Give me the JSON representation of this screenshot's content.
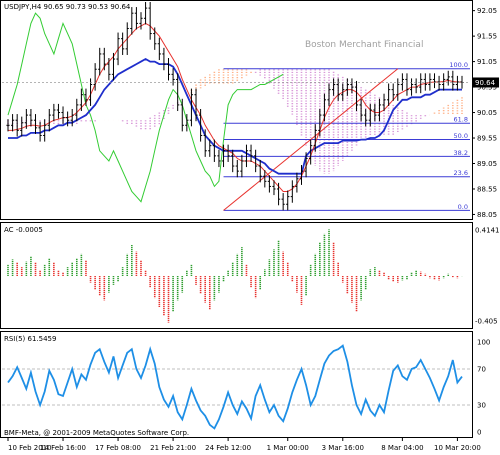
{
  "chart_data": [
    {
      "type": "line",
      "panel": "main",
      "header": "USDJPY,H4  90.65 90.73 90.53 90.64",
      "watermark": "Boston Merchant Financial",
      "current_price_label": "90.64",
      "y_ticks": [
        {
          "v": 92.05,
          "label": "92.05"
        },
        {
          "v": 91.55,
          "label": "91.55"
        },
        {
          "v": 91.05,
          "label": "91.05"
        },
        {
          "v": 90.55,
          "label": "90.55"
        },
        {
          "v": 90.05,
          "label": "90.05"
        },
        {
          "v": 89.55,
          "label": "89.55"
        },
        {
          "v": 89.05,
          "label": "89.05"
        },
        {
          "v": 88.55,
          "label": "88.55"
        },
        {
          "v": 88.05,
          "label": "88.05"
        }
      ],
      "ylim": [
        88.0,
        92.2
      ],
      "x_count": 100,
      "fibonacci": [
        {
          "label": "100.0",
          "v": 90.91
        },
        {
          "label": "61.8",
          "v": 89.84
        },
        {
          "label": "50.0",
          "v": 89.52
        },
        {
          "label": "38.2",
          "v": 89.19
        },
        {
          "label": "23.6",
          "v": 88.79
        },
        {
          "label": "0.0",
          "v": 88.13
        }
      ],
      "fib_start_x": 47,
      "fib_trendline": {
        "x1": 47,
        "y1": 88.13,
        "x2": 85,
        "y2": 90.91
      },
      "price_close": [
        89.8,
        89.9,
        89.7,
        89.85,
        90.0,
        89.9,
        89.75,
        89.6,
        89.8,
        90.0,
        90.1,
        90.05,
        89.95,
        89.9,
        90.0,
        90.2,
        90.4,
        90.3,
        90.6,
        90.9,
        91.2,
        91.0,
        90.8,
        91.1,
        91.5,
        91.3,
        91.7,
        92.0,
        91.8,
        91.9,
        92.1,
        91.6,
        91.4,
        91.2,
        91.0,
        90.8,
        90.7,
        90.2,
        89.8,
        89.9,
        90.4,
        90.0,
        89.6,
        89.3,
        89.4,
        89.2,
        89.1,
        89.3,
        89.2,
        89.0,
        88.9,
        89.1,
        89.3,
        89.2,
        89.0,
        88.8,
        88.7,
        88.6,
        88.55,
        88.35,
        88.25,
        88.4,
        88.6,
        88.75,
        88.9,
        89.15,
        89.4,
        89.7,
        90.0,
        90.3,
        90.5,
        90.6,
        90.4,
        90.5,
        90.6,
        90.55,
        90.2,
        90.0,
        89.9,
        90.1,
        90.0,
        90.2,
        90.3,
        90.5,
        90.4,
        90.6,
        90.7,
        90.5,
        90.6,
        90.55,
        90.7,
        90.6,
        90.7,
        90.65,
        90.6,
        90.7,
        90.75,
        90.6,
        90.65,
        90.64
      ],
      "series": [
        {
          "key": "tenkan",
          "color": "#e8322e",
          "values": [
            89.7,
            89.7,
            89.72,
            89.74,
            89.78,
            89.8,
            89.8,
            89.78,
            89.8,
            89.85,
            89.9,
            89.92,
            89.95,
            89.95,
            89.98,
            90.05,
            90.15,
            90.25,
            90.4,
            90.6,
            90.8,
            90.95,
            91.05,
            91.15,
            91.3,
            91.4,
            91.5,
            91.6,
            91.7,
            91.75,
            91.8,
            91.75,
            91.65,
            91.55,
            91.4,
            91.25,
            91.1,
            90.95,
            90.7,
            90.5,
            90.3,
            90.15,
            90.0,
            89.8,
            89.65,
            89.5,
            89.4,
            89.35,
            89.3,
            89.25,
            89.15,
            89.1,
            89.1,
            89.1,
            89.05,
            89.0,
            88.9,
            88.8,
            88.7,
            88.6,
            88.5,
            88.5,
            88.55,
            88.65,
            88.8,
            89.0,
            89.2,
            89.45,
            89.7,
            89.95,
            90.15,
            90.3,
            90.4,
            90.45,
            90.5,
            90.5,
            90.45,
            90.35,
            90.2,
            90.1,
            90.05,
            90.05,
            90.1,
            90.2,
            90.3,
            90.4,
            90.45,
            90.5,
            90.55,
            90.55,
            90.6,
            90.62,
            90.64,
            90.65,
            90.65,
            90.66,
            90.68,
            90.66,
            90.65,
            90.65
          ]
        },
        {
          "key": "kijun",
          "color": "#1f2ecc",
          "values": [
            89.55,
            89.55,
            89.55,
            89.6,
            89.6,
            89.65,
            89.65,
            89.65,
            89.7,
            89.7,
            89.75,
            89.8,
            89.8,
            89.85,
            89.85,
            89.9,
            89.95,
            90.0,
            90.1,
            90.2,
            90.35,
            90.5,
            90.6,
            90.7,
            90.8,
            90.85,
            90.9,
            90.95,
            91.0,
            91.05,
            91.1,
            91.05,
            91.05,
            91.0,
            91.0,
            91.0,
            90.95,
            90.8,
            90.6,
            90.4,
            90.2,
            90.0,
            89.8,
            89.6,
            89.5,
            89.4,
            89.35,
            89.3,
            89.3,
            89.3,
            89.3,
            89.3,
            89.25,
            89.2,
            89.15,
            89.1,
            89.05,
            88.95,
            88.9,
            88.85,
            88.85,
            88.85,
            88.85,
            88.85,
            88.85,
            89.2,
            89.3,
            89.35,
            89.4,
            89.45,
            89.45,
            89.45,
            89.45,
            89.5,
            89.5,
            89.5,
            89.5,
            89.52,
            89.52,
            89.55,
            89.55,
            89.6,
            89.7,
            89.9,
            90.1,
            90.2,
            90.3,
            90.3,
            90.35,
            90.35,
            90.35,
            90.4,
            90.4,
            90.45,
            90.5,
            90.5,
            90.5,
            90.5,
            90.5,
            90.5
          ]
        },
        {
          "key": "chikou",
          "color": "#33cc33",
          "values": [
            90.0,
            90.3,
            90.6,
            91.0,
            91.4,
            91.8,
            92.0,
            91.9,
            91.6,
            91.4,
            91.2,
            91.5,
            91.8,
            91.6,
            91.4,
            91.0,
            90.6,
            90.2,
            90.0,
            89.7,
            89.3,
            89.2,
            89.1,
            89.3,
            89.1,
            88.9,
            88.7,
            88.5,
            88.4,
            88.3,
            88.6,
            88.9,
            89.3,
            89.7,
            90.0,
            90.3,
            90.5,
            90.4,
            90.2,
            89.9,
            89.6,
            89.3,
            89.1,
            88.9,
            88.8,
            88.6,
            88.7,
            89.5,
            90.2,
            90.4,
            90.5,
            90.5,
            90.5,
            90.5,
            90.55,
            90.6,
            90.6,
            90.65,
            90.7,
            90.75,
            90.8,
            null,
            null,
            null,
            null,
            null,
            null,
            null,
            null,
            null,
            null,
            null,
            null,
            null,
            null,
            null,
            null,
            null,
            null,
            null,
            null,
            null,
            null,
            null,
            null,
            null,
            null,
            null,
            null,
            null,
            null,
            null,
            null,
            null,
            null,
            null,
            null,
            null,
            null,
            null
          ]
        },
        {
          "key": "senkou_a",
          "color": "#ff9966",
          "values": [
            89.75,
            89.75,
            89.75,
            89.75,
            89.75,
            89.75,
            89.75,
            89.75,
            89.8,
            89.8,
            89.8,
            89.8,
            89.8,
            89.8,
            89.8,
            89.8,
            89.85,
            89.85,
            89.85,
            89.85,
            89.9,
            89.9,
            89.9,
            89.9,
            89.9,
            89.85,
            89.8,
            89.8,
            89.75,
            89.7,
            89.7,
            89.7,
            89.75,
            89.8,
            89.9,
            90.0,
            90.1,
            90.2,
            90.3,
            90.4,
            90.5,
            90.6,
            90.7,
            90.75,
            90.8,
            90.85,
            90.9,
            90.9,
            90.9,
            90.9,
            90.9,
            90.9,
            90.9,
            90.85,
            90.8,
            90.75,
            90.7,
            90.6,
            90.5,
            90.4,
            90.3,
            90.15,
            90.0,
            89.8,
            89.6,
            89.4,
            89.2,
            89.0,
            88.9,
            88.85,
            88.85,
            88.9,
            89.0,
            89.1,
            89.2,
            89.3,
            89.4,
            89.5,
            89.55,
            89.6,
            89.6,
            89.6,
            89.6,
            89.6,
            89.6,
            89.65,
            89.7,
            89.75,
            89.8,
            89.85,
            89.9,
            89.95,
            90.0,
            90.05,
            90.1,
            90.15,
            90.2,
            90.25,
            90.3,
            90.35
          ]
        },
        {
          "key": "senkou_b",
          "color": "#cc66cc",
          "values": [
            89.9,
            89.9,
            89.9,
            89.9,
            89.9,
            89.9,
            89.9,
            89.9,
            89.9,
            89.9,
            89.9,
            89.9,
            89.9,
            89.9,
            89.9,
            89.9,
            89.9,
            89.9,
            89.9,
            89.9,
            89.9,
            89.9,
            89.9,
            89.9,
            89.9,
            89.9,
            89.9,
            89.9,
            89.9,
            89.9,
            89.9,
            89.95,
            90.0,
            90.05,
            90.1,
            90.15,
            90.2,
            90.25,
            90.3,
            90.35,
            90.4,
            90.45,
            90.5,
            90.55,
            90.6,
            90.6,
            90.6,
            90.6,
            90.6,
            90.6,
            90.65,
            90.7,
            90.75,
            90.8,
            90.85,
            90.9,
            90.9,
            90.9,
            90.9,
            90.9,
            90.9,
            90.9,
            90.9,
            90.9,
            90.9,
            90.9,
            90.9,
            90.9,
            90.9,
            90.9,
            90.9,
            90.85,
            90.8,
            90.75,
            90.7,
            90.65,
            90.6,
            90.55,
            90.5,
            90.45,
            90.4,
            90.35,
            90.3,
            90.25,
            90.2,
            90.15,
            90.1,
            90.05,
            90.0,
            90.0,
            90.0,
            90.0,
            90.0,
            90.0,
            90.0,
            90.0,
            90.0,
            90.0,
            90.0,
            90.0
          ]
        }
      ]
    },
    {
      "type": "bar",
      "panel": "ac",
      "header": "AC -0.0005",
      "y_ticks": [
        {
          "v": 0.4141,
          "label": "0.4141"
        },
        {
          "v": -0.405,
          "label": "-0.405"
        }
      ],
      "ylim": [
        -0.46,
        0.46
      ],
      "start_x": 0,
      "values": [
        0.1,
        0.15,
        0.12,
        0.08,
        0.13,
        0.18,
        0.12,
        0.05,
        0.1,
        0.16,
        0.12,
        0.05,
        0.03,
        0.08,
        0.12,
        0.16,
        0.2,
        0.14,
        -0.06,
        -0.12,
        -0.18,
        -0.22,
        -0.15,
        -0.08,
        -0.05,
        0.08,
        0.2,
        0.28,
        0.22,
        0.14,
        0.05,
        -0.1,
        -0.2,
        -0.28,
        -0.36,
        -0.42,
        -0.32,
        -0.22,
        -0.15,
        0.05,
        0.1,
        -0.08,
        -0.16,
        -0.24,
        -0.3,
        -0.22,
        -0.15,
        -0.05,
        0.05,
        0.12,
        0.2,
        0.26,
        0.1,
        -0.1,
        -0.2,
        -0.12,
        0.06,
        0.15,
        0.24,
        0.32,
        0.22,
        0.12,
        -0.05,
        -0.15,
        -0.26,
        -0.18,
        0.1,
        0.2,
        0.3,
        0.38,
        0.42,
        0.3,
        0.12,
        -0.06,
        -0.16,
        -0.24,
        -0.32,
        -0.22,
        -0.12,
        0.06,
        0.08,
        0.05,
        0.03,
        -0.03,
        -0.05,
        -0.06,
        -0.04,
        -0.03,
        0.03,
        0.05,
        0.04,
        0.02,
        -0.02,
        -0.03,
        -0.04,
        -0.02,
        0.02,
        -0.01,
        -0.02,
        -0.001
      ],
      "series": [
        {
          "key": "up",
          "color": "#2f9e2f"
        },
        {
          "key": "down",
          "color": "#e8322e"
        }
      ]
    },
    {
      "type": "line",
      "panel": "rsi",
      "header": "RSI(5) 61.5459",
      "y_ticks": [
        {
          "v": 100,
          "label": "100"
        },
        {
          "v": 70,
          "label": "70"
        },
        {
          "v": 30,
          "label": "30"
        },
        {
          "v": 0,
          "label": "0"
        }
      ],
      "ylim": [
        0,
        100
      ],
      "levels": [
        70,
        30
      ],
      "series": [
        {
          "key": "rsi",
          "color": "#1e8fe6",
          "values": [
            55,
            62,
            72,
            60,
            48,
            66,
            45,
            30,
            45,
            68,
            58,
            42,
            40,
            55,
            70,
            50,
            64,
            58,
            75,
            88,
            92,
            78,
            66,
            84,
            60,
            74,
            88,
            92,
            70,
            60,
            74,
            92,
            76,
            50,
            36,
            28,
            40,
            22,
            14,
            30,
            48,
            35,
            24,
            18,
            8,
            4,
            14,
            28,
            44,
            30,
            20,
            34,
            26,
            15,
            40,
            52,
            36,
            22,
            30,
            18,
            12,
            26,
            44,
            58,
            70,
            52,
            30,
            40,
            58,
            76,
            85,
            90,
            92,
            96,
            78,
            52,
            30,
            20,
            36,
            24,
            18,
            30,
            22,
            46,
            68,
            74,
            62,
            58,
            70,
            72,
            80,
            70,
            60,
            48,
            35,
            50,
            62,
            80,
            55,
            61.5
          ]
        }
      ]
    }
  ],
  "footer": "BMF-Meta, @ 2001-2009 MetaQuotes Software Corp.",
  "x_ticks": [
    {
      "i": 0,
      "label": "10 Feb 2010"
    },
    {
      "i": 12,
      "label": "14 Feb 16:00"
    },
    {
      "i": 24,
      "label": "17 Feb 08:00"
    },
    {
      "i": 36,
      "label": "21 Feb 21:00"
    },
    {
      "i": 48,
      "label": "24 Feb 12:00"
    },
    {
      "i": 61,
      "label": "1 Mar 00:00"
    },
    {
      "i": 73,
      "label": "3 Mar 16:00"
    },
    {
      "i": 86,
      "label": "8 Mar 04:00"
    },
    {
      "i": 98,
      "label": "10 Mar 20:00"
    }
  ]
}
